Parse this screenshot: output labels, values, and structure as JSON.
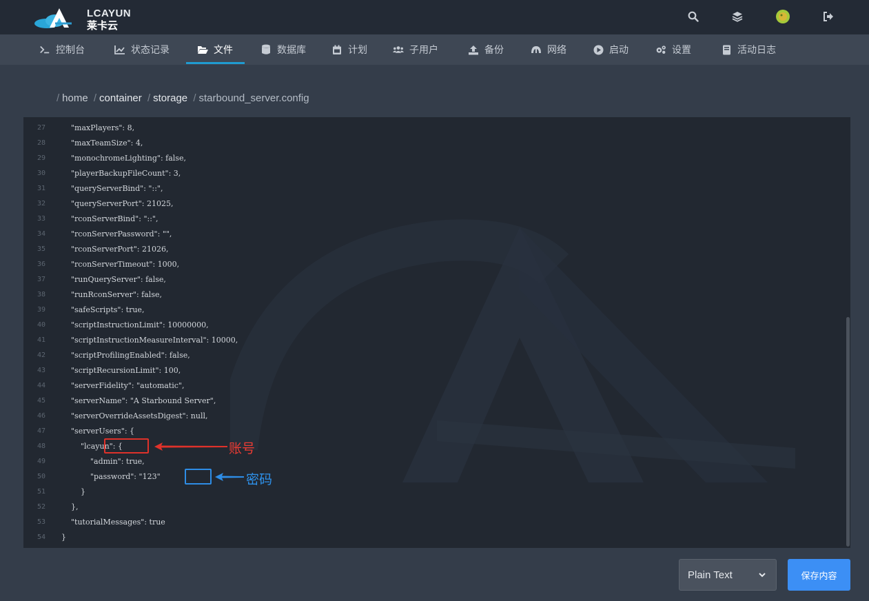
{
  "header": {
    "logo_text": "LCAYUN",
    "logo_cn": "莱卡云",
    "icons": [
      "search-icon",
      "layers-icon",
      "avatar",
      "logout-icon"
    ]
  },
  "nav": {
    "items": [
      {
        "label": "控制台",
        "icon": "terminal-icon"
      },
      {
        "label": "状态记录",
        "icon": "chart-icon"
      },
      {
        "label": "文件",
        "icon": "folder-open-icon"
      },
      {
        "label": "数据库",
        "icon": "database-icon"
      },
      {
        "label": "计划",
        "icon": "calendar-icon"
      },
      {
        "label": "子用户",
        "icon": "users-icon"
      },
      {
        "label": "备份",
        "icon": "upload-icon"
      },
      {
        "label": "网络",
        "icon": "network-icon"
      },
      {
        "label": "启动",
        "icon": "play-icon"
      },
      {
        "label": "设置",
        "icon": "cogs-icon"
      },
      {
        "label": "活动日志",
        "icon": "book-icon"
      }
    ],
    "active_index": 2
  },
  "breadcrumb": {
    "parts": [
      "home",
      "container",
      "storage"
    ],
    "file": "starbound_server.config",
    "separator": "/"
  },
  "editor": {
    "lines": [
      {
        "n": "27",
        "text": "    \"maxPlayers\": 8,"
      },
      {
        "n": "28",
        "text": "    \"maxTeamSize\": 4,"
      },
      {
        "n": "29",
        "text": "    \"monochromeLighting\": false,"
      },
      {
        "n": "30",
        "text": "    \"playerBackupFileCount\": 3,"
      },
      {
        "n": "31",
        "text": "    \"queryServerBind\": \"::\","
      },
      {
        "n": "32",
        "text": "    \"queryServerPort\": 21025,"
      },
      {
        "n": "33",
        "text": "    \"rconServerBind\": \"::\","
      },
      {
        "n": "34",
        "text": "    \"rconServerPassword\": \"\","
      },
      {
        "n": "35",
        "text": "    \"rconServerPort\": 21026,"
      },
      {
        "n": "36",
        "text": "    \"rconServerTimeout\": 1000,"
      },
      {
        "n": "37",
        "text": "    \"runQueryServer\": false,"
      },
      {
        "n": "38",
        "text": "    \"runRconServer\": false,"
      },
      {
        "n": "39",
        "text": "    \"safeScripts\": true,"
      },
      {
        "n": "40",
        "text": "    \"scriptInstructionLimit\": 10000000,"
      },
      {
        "n": "41",
        "text": "    \"scriptInstructionMeasureInterval\": 10000,"
      },
      {
        "n": "42",
        "text": "    \"scriptProfilingEnabled\": false,"
      },
      {
        "n": "43",
        "text": "    \"scriptRecursionLimit\": 100,"
      },
      {
        "n": "44",
        "text": "    \"serverFidelity\": \"automatic\","
      },
      {
        "n": "45",
        "text": "    \"serverName\": \"A Starbound Server\","
      },
      {
        "n": "46",
        "text": "    \"serverOverrideAssetsDigest\": null,"
      },
      {
        "n": "47",
        "text": "    \"serverUsers\": {"
      },
      {
        "n": "48",
        "text": "        \"lcayun\": {"
      },
      {
        "n": "49",
        "text": "            \"admin\": true,"
      },
      {
        "n": "50",
        "text": "            \"password\": \"123\""
      },
      {
        "n": "51",
        "text": "        }"
      },
      {
        "n": "52",
        "text": "    },"
      },
      {
        "n": "53",
        "text": "    \"tutorialMessages\": true"
      },
      {
        "n": "54",
        "text": "}"
      }
    ]
  },
  "annotations": {
    "account_label": "账号",
    "password_label": "密码",
    "red": "#e0322a",
    "blue": "#2e8de6"
  },
  "footer": {
    "language_value": "Plain Text",
    "save_label": "保存内容",
    "save_color": "#3c8ff5"
  }
}
